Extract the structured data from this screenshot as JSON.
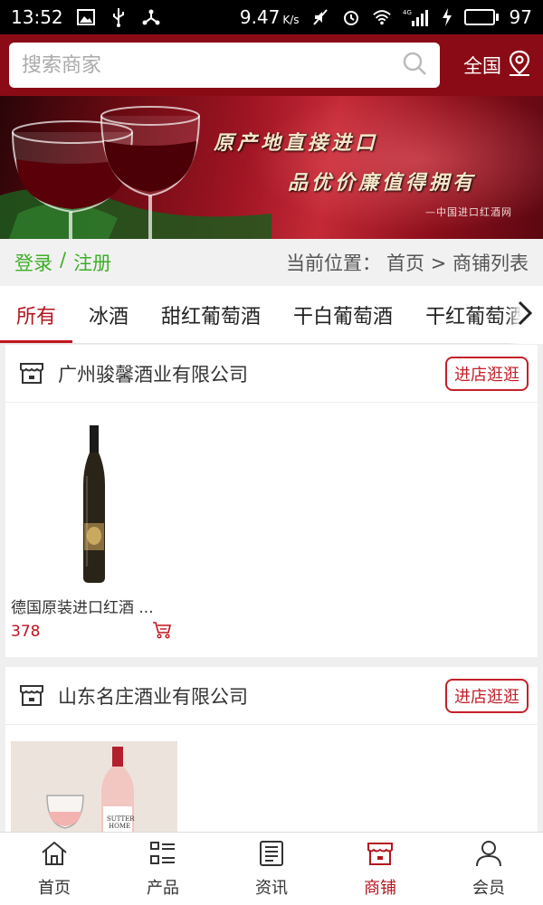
{
  "status_bar": {
    "time": "13:52",
    "speed": "9.47",
    "speed_unit": "K/s",
    "network": "4G",
    "battery": "97",
    "battery_level": 0.97
  },
  "header": {
    "search_placeholder": "搜索商家",
    "region_label": "全国"
  },
  "banner": {
    "line1": "原产地直接进口",
    "line2": "品优价廉值得拥有",
    "line3": "—中国进口红酒网"
  },
  "breadcrumb": {
    "login": "登录",
    "separator": "/",
    "register": "注册",
    "location_label": "当前位置：",
    "path": "首页 > 商铺列表"
  },
  "tabs": [
    {
      "label": "所有",
      "active": true
    },
    {
      "label": "冰酒",
      "active": false
    },
    {
      "label": "甜红葡萄酒",
      "active": false
    },
    {
      "label": "干白葡萄酒",
      "active": false
    },
    {
      "label": "干红葡萄酒",
      "active": false
    }
  ],
  "shops": [
    {
      "name": "广州骏馨酒业有限公司",
      "visit_label": "进店逛逛",
      "products": [
        {
          "name": "德国原装进口红酒 ...",
          "price": "378"
        }
      ]
    },
    {
      "name": "山东名庄酒业有限公司",
      "visit_label": "进店逛逛",
      "products": []
    }
  ],
  "bottom_nav": [
    {
      "label": "首页",
      "icon": "home-icon",
      "active": false
    },
    {
      "label": "产品",
      "icon": "grid-list-icon",
      "active": false
    },
    {
      "label": "资讯",
      "icon": "news-icon",
      "active": false
    },
    {
      "label": "商铺",
      "icon": "store-icon",
      "active": true
    },
    {
      "label": "会员",
      "icon": "user-icon",
      "active": false
    }
  ],
  "colors": {
    "brand": "#8a0b15",
    "accent": "#c4202a",
    "login_green": "#3fae29",
    "price_red": "#c0121c"
  }
}
